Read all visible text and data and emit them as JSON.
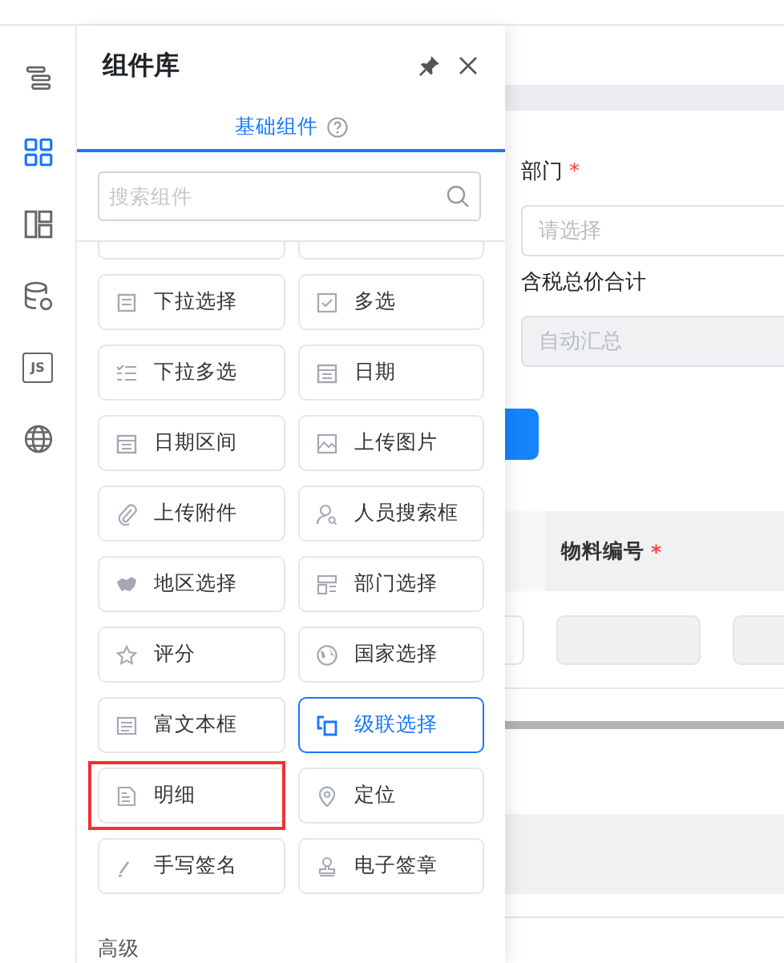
{
  "rail": [
    {
      "selected": false
    },
    {
      "selected": true
    },
    {
      "selected": false
    },
    {
      "selected": false
    },
    {
      "selected": false,
      "label": "JS"
    },
    {
      "selected": false
    }
  ],
  "panel": {
    "title": "组件库",
    "tab": {
      "label": "基础组件",
      "selected": true
    },
    "search": {
      "placeholder": "搜索组件"
    },
    "components": [
      {
        "label": "下拉选择",
        "selected": false
      },
      {
        "label": "多选",
        "selected": false
      },
      {
        "label": "下拉多选",
        "selected": false
      },
      {
        "label": "日期",
        "selected": false
      },
      {
        "label": "日期区间",
        "selected": false
      },
      {
        "label": "上传图片",
        "selected": false
      },
      {
        "label": "上传附件",
        "selected": false
      },
      {
        "label": "人员搜索框",
        "selected": false
      },
      {
        "label": "地区选择",
        "selected": false
      },
      {
        "label": "部门选择",
        "selected": false
      },
      {
        "label": "评分",
        "selected": false
      },
      {
        "label": "国家选择",
        "selected": false
      },
      {
        "label": "富文本框",
        "selected": false
      },
      {
        "label": "级联选择",
        "selected": true
      },
      {
        "label": "明细",
        "selected": false,
        "highlighted": true
      },
      {
        "label": "定位",
        "selected": false
      },
      {
        "label": "手写签名",
        "selected": false
      },
      {
        "label": "电子签章",
        "selected": false
      }
    ],
    "section": "高级"
  },
  "form": {
    "fields": [
      {
        "label": "部门",
        "required_mark": "*",
        "placeholder": "请选择",
        "disabled": false
      },
      {
        "label": "含税总价合计",
        "placeholder": "自动汇总",
        "disabled": true
      }
    ]
  },
  "table": {
    "columns": [
      {
        "label": "物料编号",
        "required_mark": "*"
      }
    ]
  }
}
